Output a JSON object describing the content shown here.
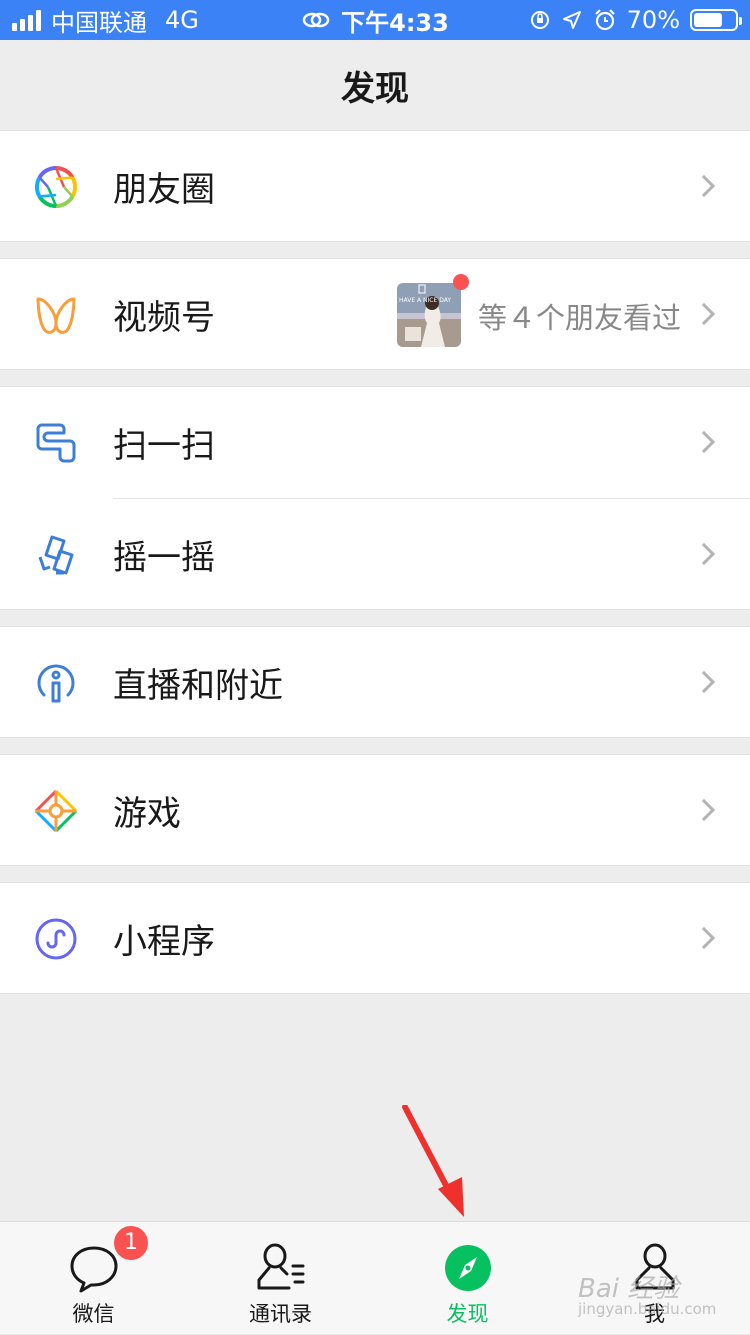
{
  "status_bar": {
    "carrier": "中国联通",
    "network": "4G",
    "time": "下午4:33",
    "battery": "70%",
    "battery_level": 0.7
  },
  "nav": {
    "title": "发现"
  },
  "rows": {
    "moments": {
      "label": "朋友圈",
      "icon": "moments-icon"
    },
    "channels": {
      "label": "视频号",
      "icon": "channels-icon",
      "extra": "等４个朋友看过",
      "thumb_text": "HAVE A NICE DAY"
    },
    "scan": {
      "label": "扫一扫",
      "icon": "scan-icon"
    },
    "shake": {
      "label": "摇一摇",
      "icon": "shake-icon"
    },
    "live": {
      "label": "直播和附近",
      "icon": "live-nearby-icon"
    },
    "games": {
      "label": "游戏",
      "icon": "games-icon"
    },
    "mini": {
      "label": "小程序",
      "icon": "mini-program-icon"
    }
  },
  "tabs": [
    {
      "label": "微信",
      "icon": "chat-icon",
      "badge": "1"
    },
    {
      "label": "通讯录",
      "icon": "contacts-icon"
    },
    {
      "label": "发现",
      "icon": "discover-compass-icon",
      "active": true
    },
    {
      "label": "我",
      "icon": "me-icon"
    }
  ],
  "watermark": {
    "text": "Bai 经验",
    "sub": "jingyan.baidu.com"
  },
  "colors": {
    "status_bar": "#3b82f6",
    "accent_green": "#07c160",
    "badge_red": "#fa5151",
    "arrow_red": "#f0302c"
  }
}
